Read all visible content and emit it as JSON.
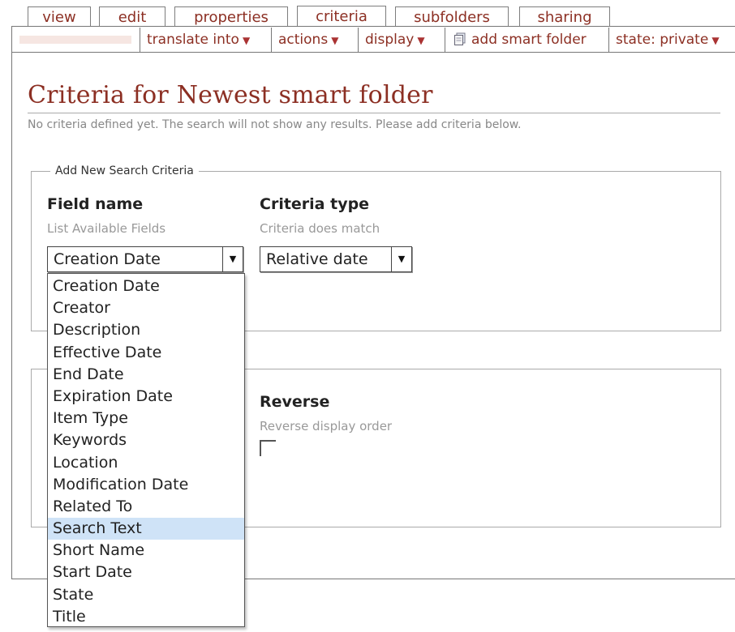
{
  "tabs": [
    "view",
    "edit",
    "properties",
    "criteria",
    "subfolders",
    "sharing"
  ],
  "toolbar": {
    "translate": "translate into",
    "actions": "actions",
    "display": "display",
    "add_smart_folder": "add smart folder",
    "state": "state: private"
  },
  "page": {
    "title": "Criteria for Newest smart folder",
    "description": "No criteria defined yet. The search will not show any results. Please add criteria below."
  },
  "add_criteria": {
    "legend": "Add New Search Criteria",
    "field_name_label": "Field name",
    "field_name_help": "List Available Fields",
    "field_name_value": "Creation Date",
    "criteria_type_label": "Criteria type",
    "criteria_type_help": "Criteria does match",
    "criteria_type_value": "Relative date"
  },
  "sort": {
    "reverse_label": "Reverse",
    "reverse_help": "Reverse display order",
    "reverse_checked": false
  },
  "dropdown_options": [
    "Creation Date",
    "Creator",
    "Description",
    "Effective Date",
    "End Date",
    "Expiration Date",
    "Item Type",
    "Keywords",
    "Location",
    "Modification Date",
    "Related To",
    "Search Text",
    "Short Name",
    "Start Date",
    "State",
    "Title"
  ],
  "highlighted_option": "Search Text",
  "colors": {
    "accent": "#8c2f23",
    "highlight": "#cfe3f7"
  },
  "icons": {
    "dropdown_arrow": "triangle-down-icon",
    "smart_folder": "document-icon"
  }
}
